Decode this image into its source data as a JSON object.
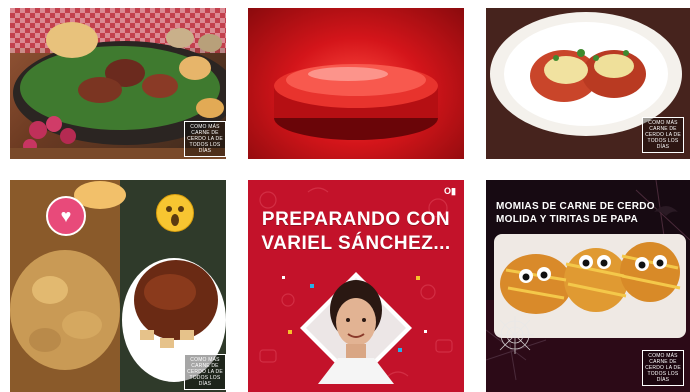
{
  "posts": [
    {
      "badge": "COMO MÁS CARNE DE CERDO LA DE TODOS LOS DÍAS"
    },
    {},
    {
      "badge": "COMO MÁS CARNE DE CERDO LA DE TODOS LOS DÍAS"
    },
    {
      "badge": "COMO MÁS CARNE DE CERDO LA DE TODOS LOS DÍAS"
    },
    {
      "headline_line1": "PREPARANDO CON",
      "headline_line2": "VARIEL SÁNCHEZ...",
      "video_icon": "O▮"
    },
    {
      "headline_line1": "MOMIAS DE CARNE DE CERDO",
      "headline_line2": "MOLIDA Y TIRITAS DE PAPA",
      "badge": "COMO MÁS CARNE DE CERDO LA DE TODOS LOS DÍAS"
    }
  ],
  "icons": {
    "heart": "heart-reaction-icon",
    "wow": "wow-reaction-icon",
    "video": "video-icon"
  },
  "colors": {
    "red": "#c3122a",
    "dark": "#150b10"
  }
}
